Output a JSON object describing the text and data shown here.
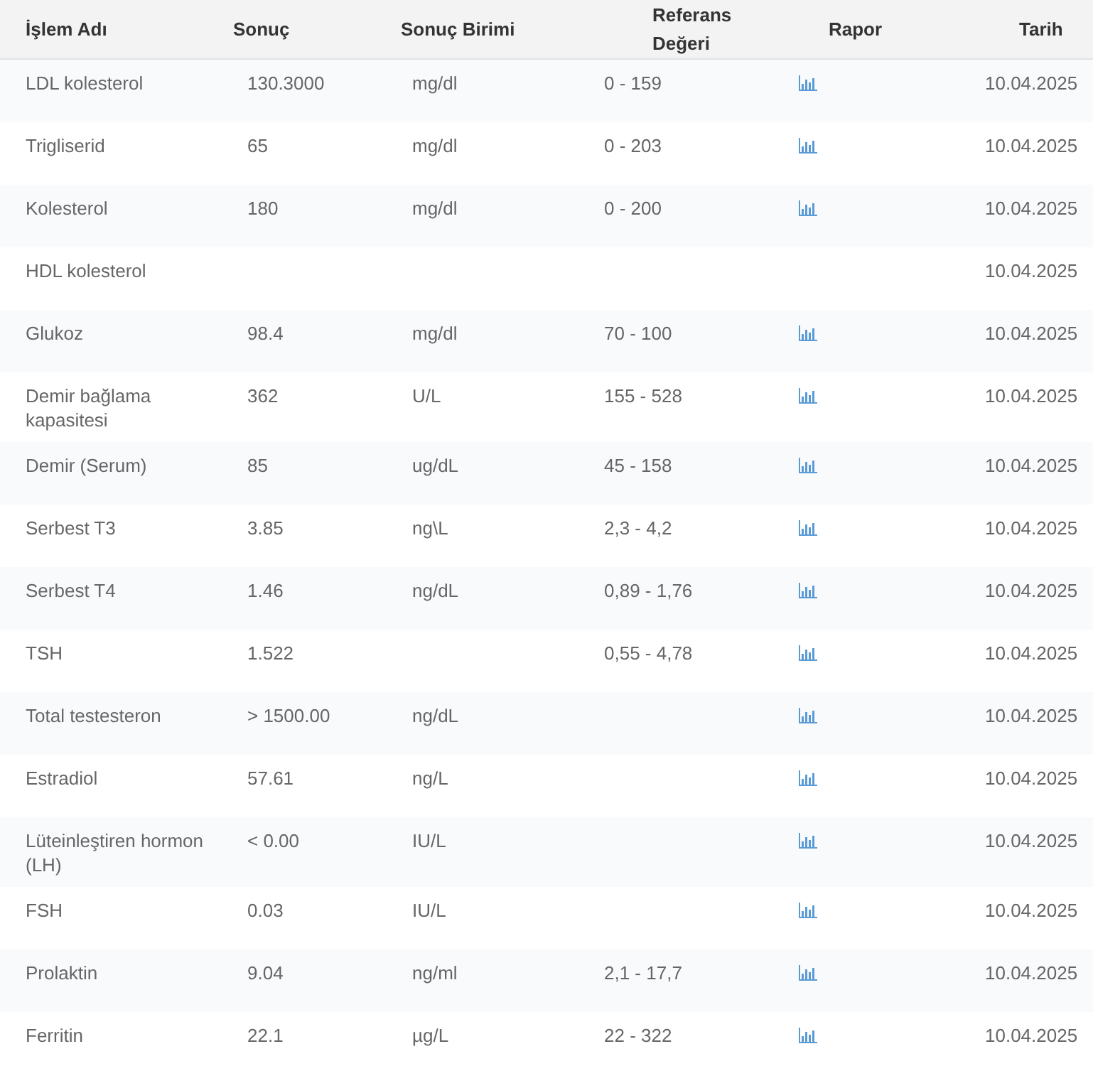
{
  "table": {
    "columns": [
      "İşlem Adı",
      "Sonuç",
      "Sonuç Birimi",
      "Referans Değeri",
      "Rapor",
      "Tarih"
    ],
    "rows": [
      {
        "name": "LDL kolesterol",
        "result": "130.3000",
        "unit": "mg/dl",
        "reference": "0 - 159",
        "report": true,
        "date": "10.04.2025"
      },
      {
        "name": "Trigliserid",
        "result": "65",
        "unit": "mg/dl",
        "reference": "0 - 203",
        "report": true,
        "date": "10.04.2025"
      },
      {
        "name": "Kolesterol",
        "result": "180",
        "unit": "mg/dl",
        "reference": "0 - 200",
        "report": true,
        "date": "10.04.2025"
      },
      {
        "name": "HDL kolesterol",
        "report": false,
        "date": "10.04.2025"
      },
      {
        "name": "Glukoz",
        "result": "98.4",
        "unit": "mg/dl",
        "reference": "70 - 100",
        "report": true,
        "date": "10.04.2025"
      },
      {
        "name": "Demir bağlama kapasitesi",
        "result": "362",
        "unit": "U/L",
        "reference": "155 - 528",
        "report": true,
        "date": "10.04.2025"
      },
      {
        "name": "Demir (Serum)",
        "result": "85",
        "unit": "ug/dL",
        "reference": "45 - 158",
        "report": true,
        "date": "10.04.2025"
      },
      {
        "name": "Serbest T3",
        "result": "3.85",
        "unit": "ng\\L",
        "reference": "2,3 - 4,2",
        "report": true,
        "date": "10.04.2025"
      },
      {
        "name": "Serbest T4",
        "result": "1.46",
        "unit": "ng/dL",
        "reference": "0,89 - 1,76",
        "report": true,
        "date": "10.04.2025"
      },
      {
        "name": "TSH",
        "result": "1.522",
        "reference": "0,55 - 4,78",
        "report": true,
        "date": "10.04.2025"
      },
      {
        "name": "Total testesteron",
        "result": "> 1500.00",
        "unit": "ng/dL",
        "report": true,
        "date": "10.04.2025"
      },
      {
        "name": "Estradiol",
        "result": "57.61",
        "unit": "ng/L",
        "report": true,
        "date": "10.04.2025"
      },
      {
        "name": "Lüteinleştiren hormon (LH)",
        "result": "< 0.00",
        "unit": "IU/L",
        "report": true,
        "date": "10.04.2025"
      },
      {
        "name": "FSH",
        "result": "0.03",
        "unit": "IU/L",
        "report": true,
        "date": "10.04.2025"
      },
      {
        "name": "Prolaktin",
        "result": "9.04",
        "unit": "ng/ml",
        "reference": "2,1 - 17,7",
        "report": true,
        "date": "10.04.2025"
      },
      {
        "name": "Ferritin",
        "result": "22.1",
        "unit": "µg/L",
        "reference": "22 - 322",
        "report": true,
        "date": "10.04.2025"
      }
    ]
  }
}
